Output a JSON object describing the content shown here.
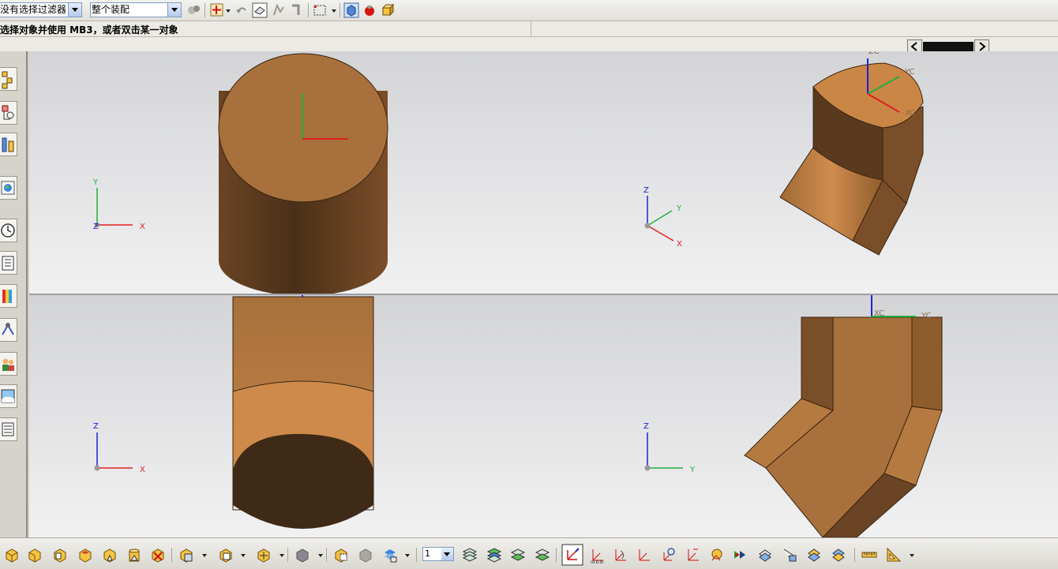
{
  "toolbar": {
    "filter_value": "没有选择过滤器",
    "scope_value": "整个装配",
    "layer_value": "1"
  },
  "status": {
    "prompt": "选择对象并使用 MB3，或者双击某一对象"
  },
  "icons": {
    "top": [
      "filter-reset-icon",
      "snap-point-icon",
      "erase-select-icon",
      "undo-icon",
      "redo-icon",
      "selection-box-icon",
      "shaded-view-icon",
      "highlight-icon",
      "view-cube-icon"
    ],
    "left": [
      "assembly-navigator-icon",
      "constraint-navigator-icon",
      "part-navigator-icon",
      "web-browser-icon",
      "history-icon",
      "reuse-library-icon",
      "palette-icon",
      "process-studio-icon",
      "roles-icon",
      "system-scenes-icon",
      "system-materials-icon"
    ],
    "bottom": [
      "view-fit-icon",
      "view-front-icon",
      "view-right-icon",
      "view-top-icon",
      "view-iso-icon",
      "view-left-icon",
      "view-trimetric-icon",
      "zoom-icon",
      "pan-icon",
      "view-layout-icon",
      "shade-edges-icon",
      "hidden-edges-icon",
      "layer-settings-icon",
      "layer-visible-icon",
      "move-to-layer-icon",
      "copy-to-layer-icon",
      "wcs-icon",
      "wcs-origin-icon",
      "wcs-rotate-icon",
      "wcs-orient-icon",
      "wcs-set-icon",
      "wcs-display-icon",
      "wcs-save-icon",
      "transform-icon",
      "point-icon",
      "vector-icon",
      "plane-icon",
      "csys-icon",
      "measure-distance-icon",
      "measure-angle-icon"
    ]
  },
  "colors": {
    "part_top": "#a8703c",
    "part_side_light": "#cd8a4a",
    "part_side_dark": "#4a2f18",
    "axis_x": "#e02020",
    "axis_y": "#20b040",
    "axis_z": "#2020d0"
  },
  "viewports": {
    "top_left": {
      "name": "top-view",
      "axes": [
        "Y",
        "Z",
        "X"
      ]
    },
    "top_right": {
      "name": "iso-view",
      "axes": [
        "Z",
        "Y",
        "X"
      ],
      "wcs": [
        "ZC",
        "YC",
        "XC"
      ]
    },
    "bottom_left": {
      "name": "front-view",
      "axes": [
        "Z",
        "X"
      ]
    },
    "bottom_right": {
      "name": "right-view",
      "axes": [
        "Z",
        "Y"
      ],
      "wcs": [
        "XC",
        "YC"
      ]
    }
  }
}
